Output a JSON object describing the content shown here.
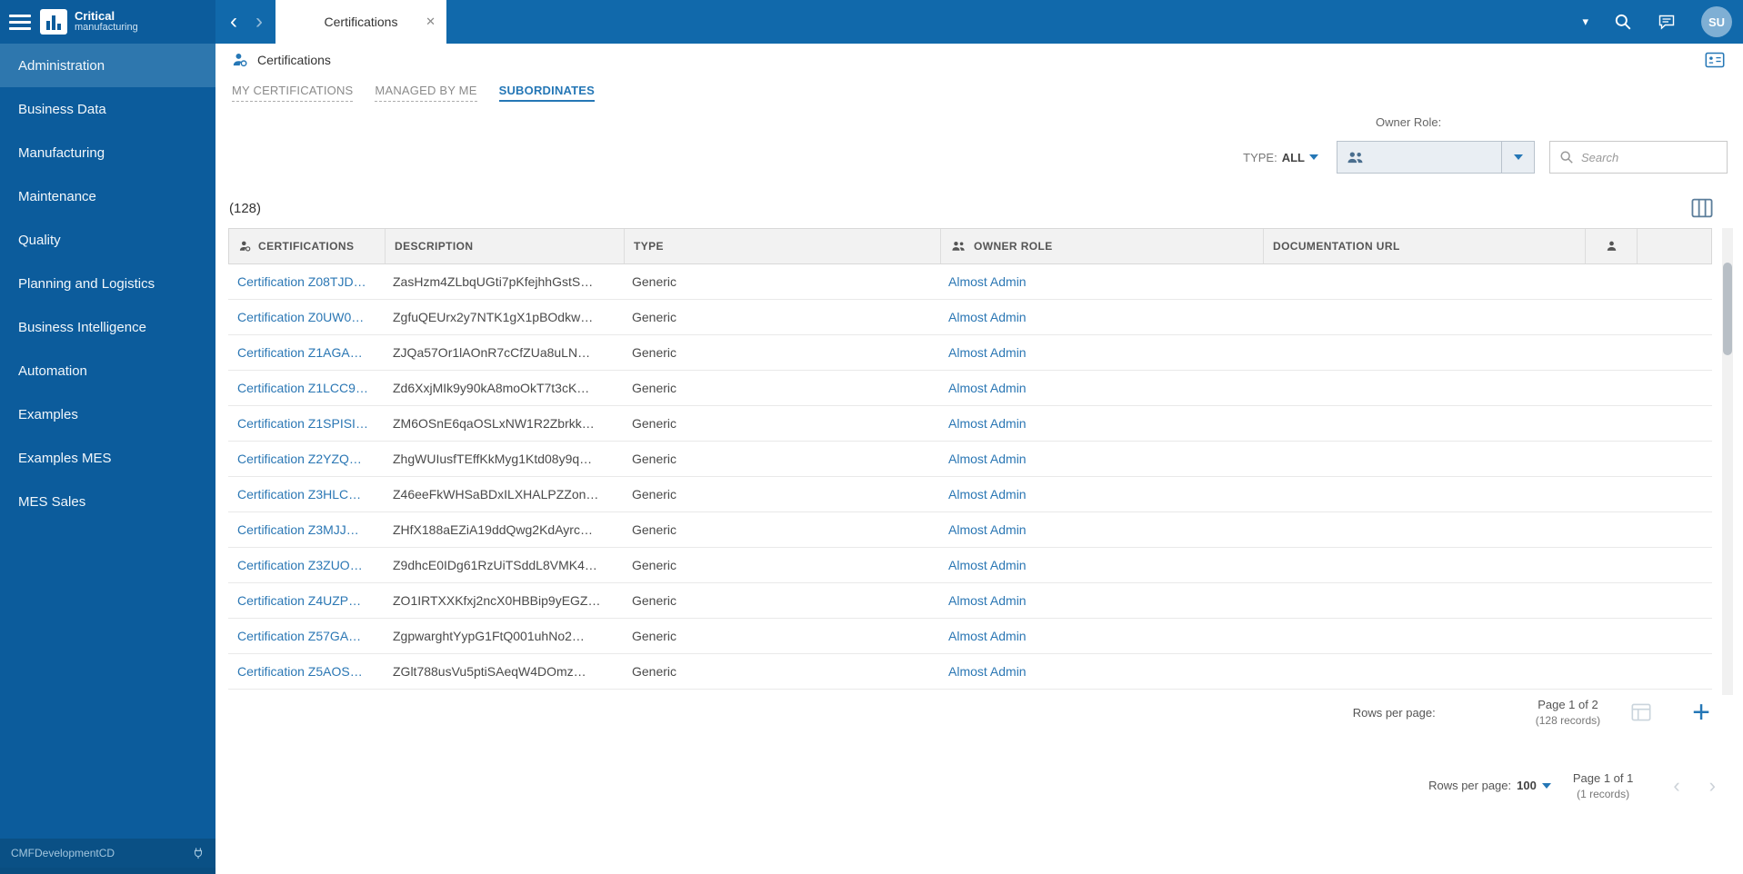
{
  "colors": {
    "topbar": "#1169ab",
    "sidebar": "#0c5c9c",
    "sidebar_active": "#2e77ae",
    "accent": "#2577b6",
    "link": "#2b77b4",
    "avatar_bg": "#7fafd4"
  },
  "sidebar": {
    "logo_line1": "Critical",
    "logo_line2": "manufacturing",
    "items": [
      {
        "label": "Administration",
        "active": true
      },
      {
        "label": "Business Data",
        "active": false
      },
      {
        "label": "Manufacturing",
        "active": false
      },
      {
        "label": "Maintenance",
        "active": false
      },
      {
        "label": "Quality",
        "active": false
      },
      {
        "label": "Planning and Logistics",
        "active": false
      },
      {
        "label": "Business Intelligence",
        "active": false
      },
      {
        "label": "Automation",
        "active": false
      },
      {
        "label": "Examples",
        "active": false
      },
      {
        "label": "Examples MES",
        "active": false
      },
      {
        "label": "MES Sales",
        "active": false
      }
    ],
    "footer": "CMFDevelopmentCD"
  },
  "topbar": {
    "back_glyph": "‹",
    "forward_glyph": "›",
    "tab_title": "Certifications",
    "close_glyph": "✕",
    "menu_caret_glyph": "▾",
    "avatar_initials": "SU"
  },
  "page": {
    "breadcrumb_title": "Certifications",
    "tabs": [
      {
        "label": "MY CERTIFICATIONS",
        "active": false
      },
      {
        "label": "MANAGED BY ME",
        "active": false
      },
      {
        "label": "SUBORDINATES",
        "active": true
      }
    ],
    "filters": {
      "type_label": "TYPE:",
      "type_value": "ALL",
      "owner_role_label": "Owner Role:",
      "search_placeholder": "Search"
    },
    "count": "(128)"
  },
  "table": {
    "columns": [
      "CERTIFICATIONS",
      "DESCRIPTION",
      "TYPE",
      "OWNER ROLE",
      "DOCUMENTATION URL"
    ],
    "rows": [
      {
        "name": "Certification Z08TJD…",
        "description": "ZasHzm4ZLbqUGti7pKfejhhGstS…",
        "type": "Generic",
        "owner_role": "Almost Admin",
        "documentation_url": ""
      },
      {
        "name": "Certification Z0UW0…",
        "description": "ZgfuQEUrx2y7NTK1gX1pBOdkw…",
        "type": "Generic",
        "owner_role": "Almost Admin",
        "documentation_url": ""
      },
      {
        "name": "Certification Z1AGA…",
        "description": "ZJQa57Or1lAOnR7cCfZUa8uLN…",
        "type": "Generic",
        "owner_role": "Almost Admin",
        "documentation_url": ""
      },
      {
        "name": "Certification Z1LCC9…",
        "description": "Zd6XxjMIk9y90kA8moOkT7t3cK…",
        "type": "Generic",
        "owner_role": "Almost Admin",
        "documentation_url": ""
      },
      {
        "name": "Certification Z1SPISI…",
        "description": "ZM6OSnE6qaOSLxNW1R2Zbrkk…",
        "type": "Generic",
        "owner_role": "Almost Admin",
        "documentation_url": ""
      },
      {
        "name": "Certification Z2YZQ…",
        "description": "ZhgWUIusfTEffKkMyg1Ktd08y9q…",
        "type": "Generic",
        "owner_role": "Almost Admin",
        "documentation_url": ""
      },
      {
        "name": "Certification Z3HLC…",
        "description": "Z46eeFkWHSaBDxILXHALPZZon…",
        "type": "Generic",
        "owner_role": "Almost Admin",
        "documentation_url": ""
      },
      {
        "name": "Certification Z3MJJ…",
        "description": "ZHfX188aEZiA19ddQwg2KdAyrc…",
        "type": "Generic",
        "owner_role": "Almost Admin",
        "documentation_url": ""
      },
      {
        "name": "Certification Z3ZUO…",
        "description": "Z9dhcE0IDg61RzUiTSddL8VMK4…",
        "type": "Generic",
        "owner_role": "Almost Admin",
        "documentation_url": ""
      },
      {
        "name": "Certification Z4UZP…",
        "description": "ZO1IRTXXKfxj2ncX0HBBip9yEGZ…",
        "type": "Generic",
        "owner_role": "Almost Admin",
        "documentation_url": ""
      },
      {
        "name": "Certification Z57GA…",
        "description": "ZgpwarghtYypG1FtQ001uhNo2…",
        "type": "Generic",
        "owner_role": "Almost Admin",
        "documentation_url": ""
      },
      {
        "name": "Certification Z5AOS…",
        "description": "ZGlt788usVu5ptiSAeqW4DOmz…",
        "type": "Generic",
        "owner_role": "Almost Admin",
        "documentation_url": ""
      }
    ]
  },
  "pagination_grid": {
    "rows_per_page_label": "Rows per page:",
    "page_info": "Page 1 of 2",
    "records_info": "(128 records)",
    "add_glyph": "+"
  },
  "pagination_outer": {
    "rows_per_page_label": "Rows per page:",
    "rows_per_page_value": "100",
    "page_info": "Page 1 of 1",
    "records_info": "(1 records)",
    "prev_glyph": "‹",
    "next_glyph": "›"
  }
}
